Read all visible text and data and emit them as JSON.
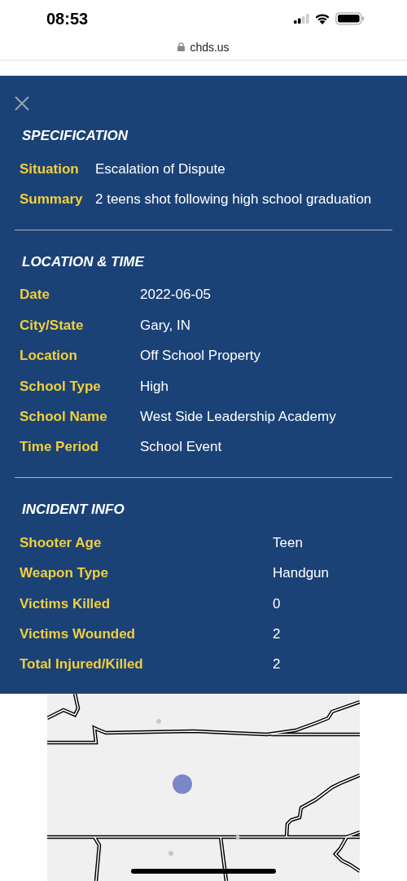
{
  "status_bar": {
    "time": "08:53"
  },
  "browser": {
    "url": "chds.us"
  },
  "sections": [
    {
      "title": "SPECIFICATION",
      "rows": [
        {
          "label": "Situation",
          "value": "Escalation of Dispute"
        },
        {
          "label": "Summary",
          "value": "2 teens shot following high school graduation"
        }
      ]
    },
    {
      "title": "LOCATION & TIME",
      "rows": [
        {
          "label": "Date",
          "value": "2022-06-05"
        },
        {
          "label": "City/State",
          "value": "Gary, IN"
        },
        {
          "label": "Location",
          "value": "Off School Property"
        },
        {
          "label": "School Type",
          "value": "High"
        },
        {
          "label": "School Name",
          "value": "West Side Leadership Academy"
        },
        {
          "label": "Time Period",
          "value": "School Event"
        }
      ]
    },
    {
      "title": "INCIDENT INFO",
      "rows": [
        {
          "label": "Shooter Age",
          "value": "Teen"
        },
        {
          "label": "Weapon Type",
          "value": "Handgun"
        },
        {
          "label": "Victims Killed",
          "value": "0"
        },
        {
          "label": "Victims Wounded",
          "value": "2"
        },
        {
          "label": "Total Injured/Killed",
          "value": "2"
        }
      ]
    }
  ]
}
